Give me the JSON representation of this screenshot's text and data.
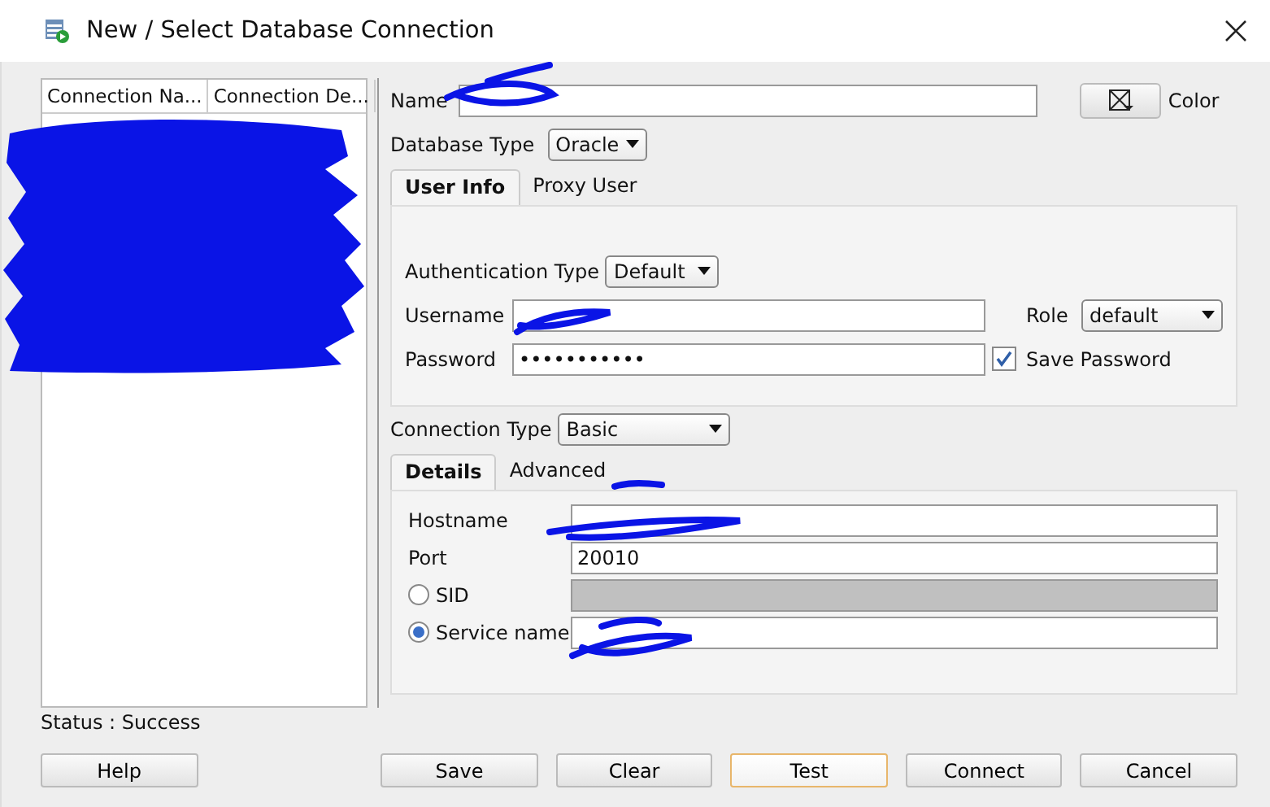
{
  "window": {
    "title": "New / Select Database Connection"
  },
  "connections_table": {
    "columns": [
      "Connection Na...",
      "Connection De..."
    ]
  },
  "name_field": {
    "label": "Name"
  },
  "color_button": {
    "label": "Color"
  },
  "database_type": {
    "label": "Database Type",
    "value": "Oracle"
  },
  "user_tabs": [
    {
      "label": "User Info",
      "selected": true
    },
    {
      "label": "Proxy User",
      "selected": false
    }
  ],
  "authentication_type": {
    "label": "Authentication Type",
    "value": "Default"
  },
  "username": {
    "label": "Username"
  },
  "password": {
    "label": "Password",
    "value": "•••••••••••"
  },
  "role": {
    "label": "Role",
    "value": "default"
  },
  "save_password": {
    "label": "Save Password",
    "checked": true
  },
  "connection_type": {
    "label": "Connection Type",
    "value": "Basic"
  },
  "detail_tabs": [
    {
      "label": "Details",
      "selected": true
    },
    {
      "label": "Advanced",
      "selected": false
    }
  ],
  "hostname": {
    "label": "Hostname"
  },
  "port": {
    "label": "Port",
    "value": "20010"
  },
  "connect_by": [
    {
      "label": "SID",
      "selected": false
    },
    {
      "label": "Service name",
      "selected": true
    }
  ],
  "status": "Status : Success",
  "buttons": [
    {
      "label": "Help",
      "focused": false
    },
    {
      "label": "Save",
      "focused": false
    },
    {
      "label": "Clear",
      "focused": false
    },
    {
      "label": "Test",
      "focused": true
    },
    {
      "label": "Connect",
      "focused": false
    },
    {
      "label": "Cancel",
      "focused": false
    }
  ]
}
